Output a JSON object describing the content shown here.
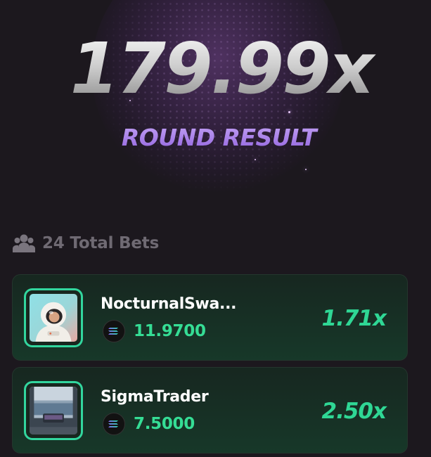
{
  "result": {
    "multiplier": "179.99x",
    "label": "ROUND RESULT"
  },
  "bets": {
    "total_label": "24 Total Bets",
    "icon": "users-icon",
    "items": [
      {
        "player": "NocturnalSwa...",
        "avatar": "astronaut-avatar",
        "amount": "11.9700",
        "currency_icon": "solana-icon",
        "multiplier": "1.71x"
      },
      {
        "player": "SigmaTrader",
        "avatar": "balcony-seaview-avatar",
        "amount": "7.5000",
        "currency_icon": "solana-icon",
        "multiplier": "2.50x"
      }
    ]
  },
  "colors": {
    "background": "#1c181e",
    "accent_purple": "#a77de6",
    "accent_green": "#32d69e",
    "card_bg": "#173829"
  }
}
